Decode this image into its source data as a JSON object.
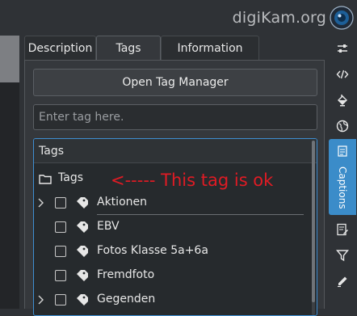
{
  "brand": {
    "text": "digiKam.org"
  },
  "tabs": [
    {
      "label": "Description",
      "active": false
    },
    {
      "label": "Tags",
      "active": true
    },
    {
      "label": "Information",
      "active": false
    }
  ],
  "panel": {
    "open_tag_manager_label": "Open Tag Manager",
    "tag_input_placeholder": "Enter tag here."
  },
  "tree": {
    "header": "Tags",
    "root_label": "Tags",
    "annotation": "<----- This tag is ok",
    "items": [
      {
        "label": "Aktionen",
        "expandable": true,
        "checked": false
      },
      {
        "label": "EBV",
        "expandable": false,
        "checked": false
      },
      {
        "label": "Fotos Klasse 5a+6a",
        "expandable": false,
        "checked": false
      },
      {
        "label": "Fremdfoto",
        "expandable": false,
        "checked": false
      },
      {
        "label": "Gegenden",
        "expandable": true,
        "checked": false
      }
    ]
  },
  "sidebar": {
    "buttons": [
      "adjust-icon",
      "code-icon",
      "paint-bucket-icon",
      "globe-icon",
      "captions-icon",
      "document-edit-icon",
      "filter-icon",
      "pencil-icon"
    ],
    "captions_label": "Captions"
  },
  "colors": {
    "accent": "#3b8cc9",
    "annotation": "#e01b24",
    "background": "#2f3236"
  }
}
